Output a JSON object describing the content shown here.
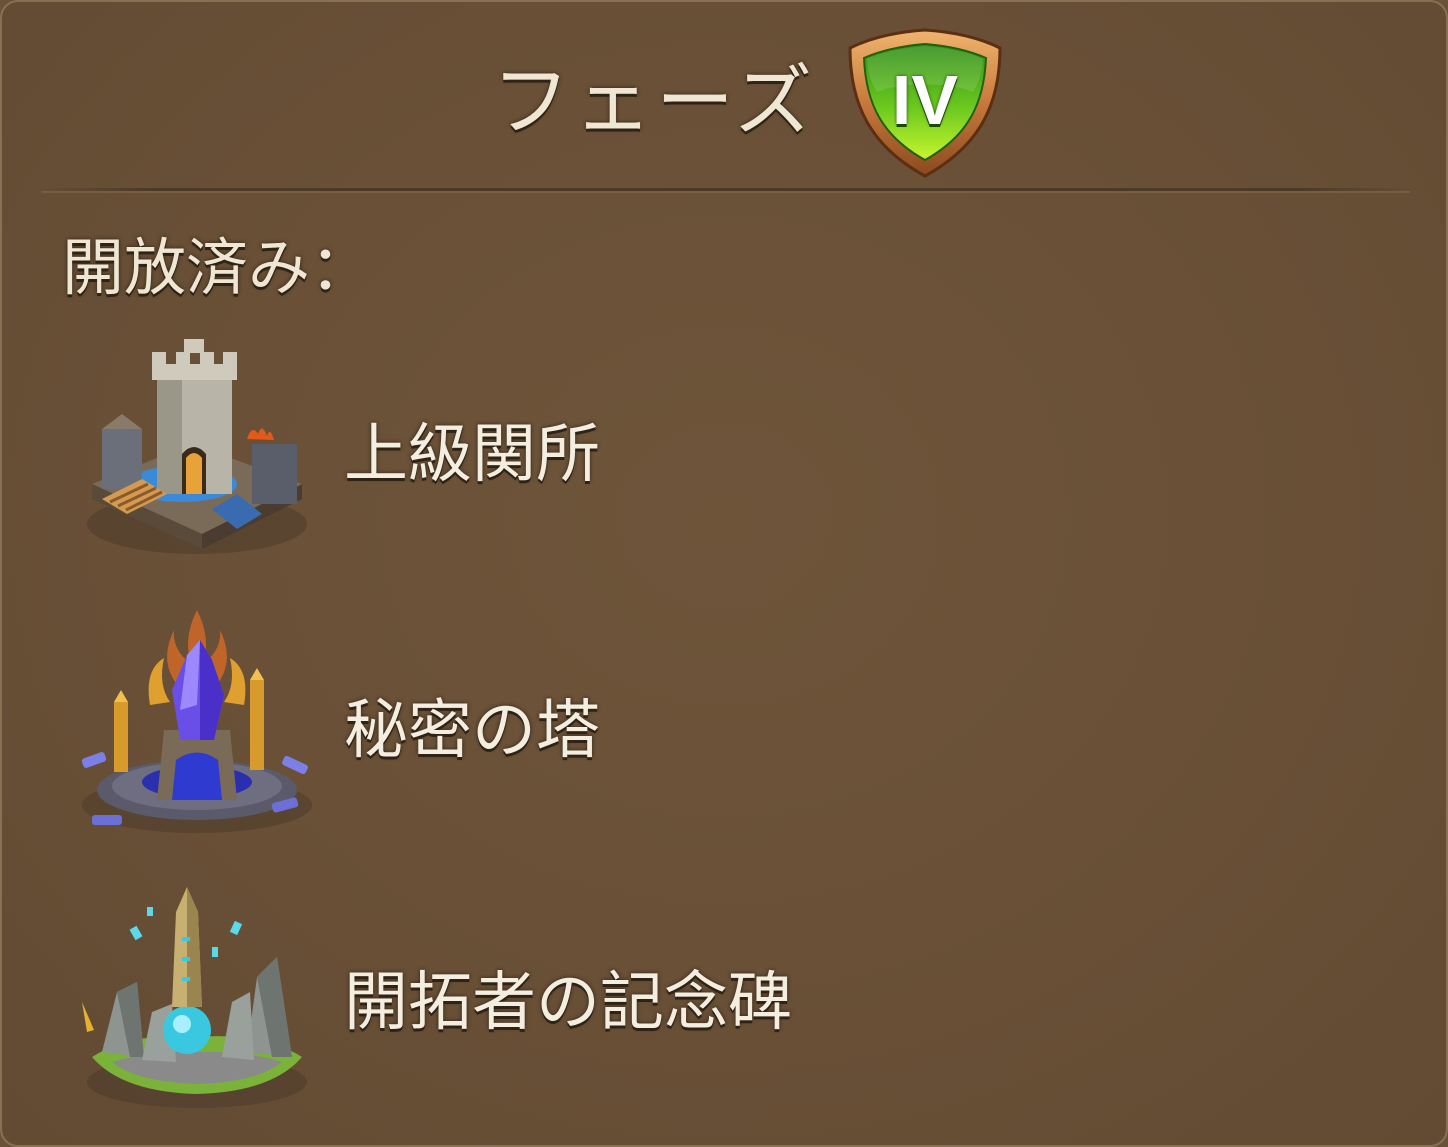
{
  "header": {
    "title": "フェーズ",
    "phase_numeral": "IV",
    "badge_icon": "green-shield-badge-icon",
    "badge_colors": {
      "rim": "#c7793c",
      "fill_top": "#3fa01e",
      "fill_bottom": "#b5ee2c"
    }
  },
  "section": {
    "unlocked_label": "開放済み："
  },
  "unlocked_items": [
    {
      "label": "上級関所",
      "icon": "castle-gate-icon"
    },
    {
      "label": "秘密の塔",
      "icon": "crystal-tower-icon"
    },
    {
      "label": "開拓者の記念碑",
      "icon": "obelisk-monument-icon"
    }
  ],
  "colors": {
    "panel_background": "#6a5238",
    "text": "#efe7d3"
  }
}
